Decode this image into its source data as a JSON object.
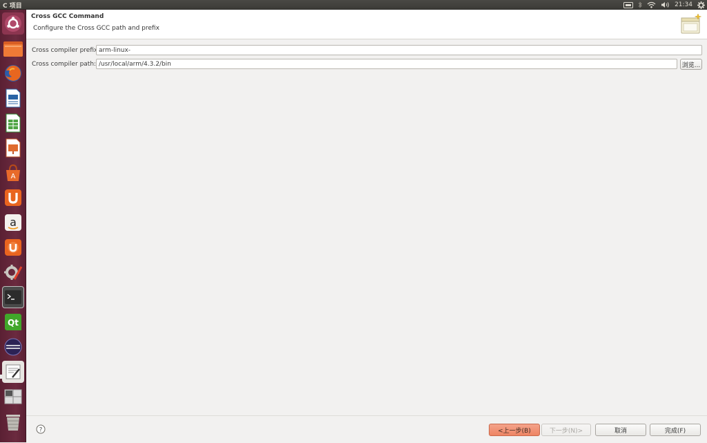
{
  "top_panel": {
    "app_title": "C 项目",
    "clock": "21:34"
  },
  "launcher": {
    "items": [
      {
        "name": "dash-home-icon"
      },
      {
        "name": "files-icon"
      },
      {
        "name": "firefox-icon"
      },
      {
        "name": "libreoffice-writer-icon"
      },
      {
        "name": "libreoffice-calc-icon"
      },
      {
        "name": "libreoffice-impress-icon"
      },
      {
        "name": "software-center-icon"
      },
      {
        "name": "ubuntu-one-icon"
      },
      {
        "name": "amazon-icon"
      },
      {
        "name": "ubuntu-one-music-icon"
      },
      {
        "name": "system-settings-icon"
      },
      {
        "name": "terminal-icon"
      },
      {
        "name": "qt-creator-icon"
      },
      {
        "name": "eclipse-icon"
      },
      {
        "name": "text-editor-icon"
      },
      {
        "name": "workspace-switcher-icon"
      },
      {
        "name": "trash-icon"
      }
    ]
  },
  "wizard": {
    "title": "Cross GCC Command",
    "description": "Configure the Cross GCC path and prefix",
    "fields": {
      "prefix_label": "Cross compiler prefix:",
      "prefix_value": "arm-linux-",
      "path_label": "Cross compiler path:",
      "path_value": "/usr/local/arm/4.3.2/bin",
      "browse_label": "浏览..."
    },
    "buttons": {
      "back": "<上一步(B)",
      "next": "下一步(N)>",
      "cancel": "取消",
      "finish": "完成(F)"
    },
    "help_icon": "help-icon"
  },
  "colors": {
    "accent": "#ee8463",
    "launcher_bg": "#6b2a3f",
    "panel_bg": "#3c3b37",
    "window_bg": "#f2f1f0"
  }
}
